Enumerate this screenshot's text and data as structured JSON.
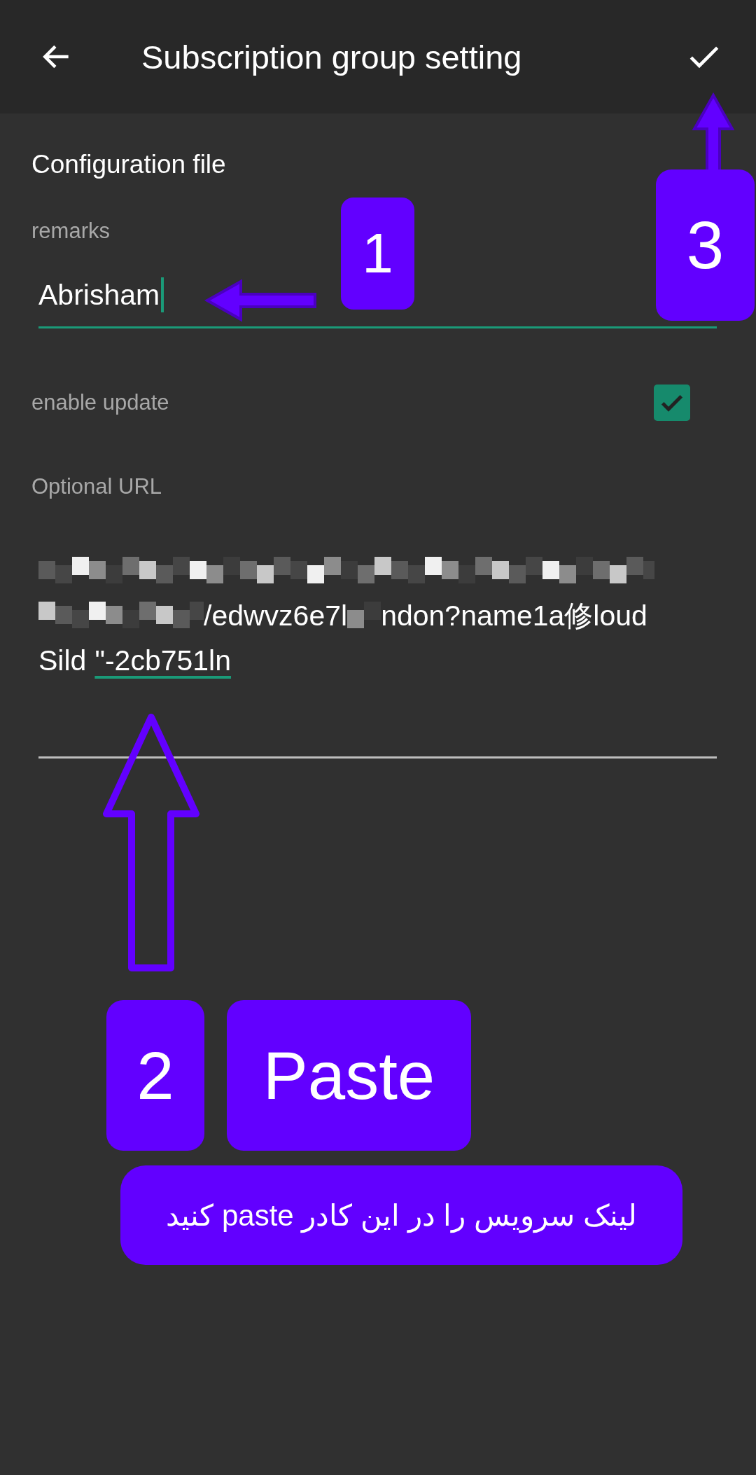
{
  "app_bar": {
    "title": "Subscription group setting"
  },
  "section_title": "Configuration file",
  "remarks": {
    "label": "remarks",
    "value": "Abrisham",
    "focused": true
  },
  "enable_update": {
    "label": "enable update",
    "checked": true
  },
  "url": {
    "label": "Optional URL",
    "line_2_parts": [
      "/edwvz6e7l",
      "ndon?name1a修loud"
    ],
    "line_3": "Sild",
    "composing": "\"-2cb751ln"
  },
  "callouts": [
    {
      "text": "1"
    },
    {
      "text": "3"
    },
    {
      "text": "2"
    },
    {
      "text": "Paste"
    },
    {
      "text": "لینک سرویس را در این کادر  paste کنید"
    }
  ]
}
